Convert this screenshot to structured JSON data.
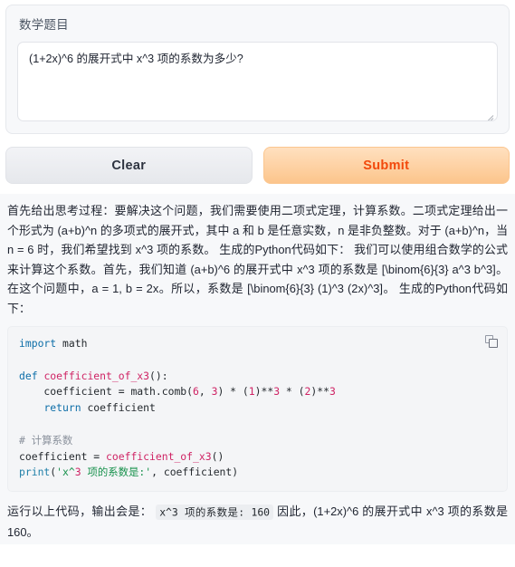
{
  "input_panel": {
    "label": "数学题目",
    "textarea_value": "(1+2x)^6 的展开式中 x^3 项的系数为多少?",
    "textarea_placeholder": "",
    "resize_grip_name": "resize-grip-icon"
  },
  "buttons": {
    "clear_label": "Clear",
    "submit_label": "Submit",
    "clear_color": "#e6e8ec",
    "submit_color": "#fcc58c",
    "submit_text_color": "#f2490c"
  },
  "response": {
    "intro_paragraph": "首先给出思考过程：要解决这个问题，我们需要使用二项式定理，计算系数。二项式定理给出一个形式为 (a+b)^n 的多项式的展开式，其中 a 和 b 是任意实数，n 是非负整数。对于 (a+b)^n，当 n = 6 时，我们希望找到 x^3 项的系数。 生成的Python代码如下： 我们可以使用组合数学的公式来计算这个系数。首先，我们知道 (a+b)^6 的展开式中 x^3 项的系数是 [\\binom{6}{3} a^3 b^3]。在这个问题中，a = 1, b = 2x。所以，系数是 [\\binom{6}{3} (1)^3 (2x)^3]。 生成的Python代码如下：",
    "code_block": {
      "language": "python",
      "copy_icon": "copy-icon",
      "lines": [
        "import math",
        "",
        "def coefficient_of_x3():",
        "    coefficient = math.comb(6, 3) * (1)**3 * (2)**3",
        "    return coefficient",
        "",
        "# 计算系数",
        "coefficient = coefficient_of_x3()",
        "print('x^3 项的系数是:', coefficient)"
      ]
    },
    "conclusion_prefix": "运行以上代码，输出会是：",
    "conclusion_inline_code": "x^3 项的系数是: 160",
    "conclusion_suffix": "因此，(1+2x)^6 的展开式中 x^3 项的系数是 160。"
  }
}
